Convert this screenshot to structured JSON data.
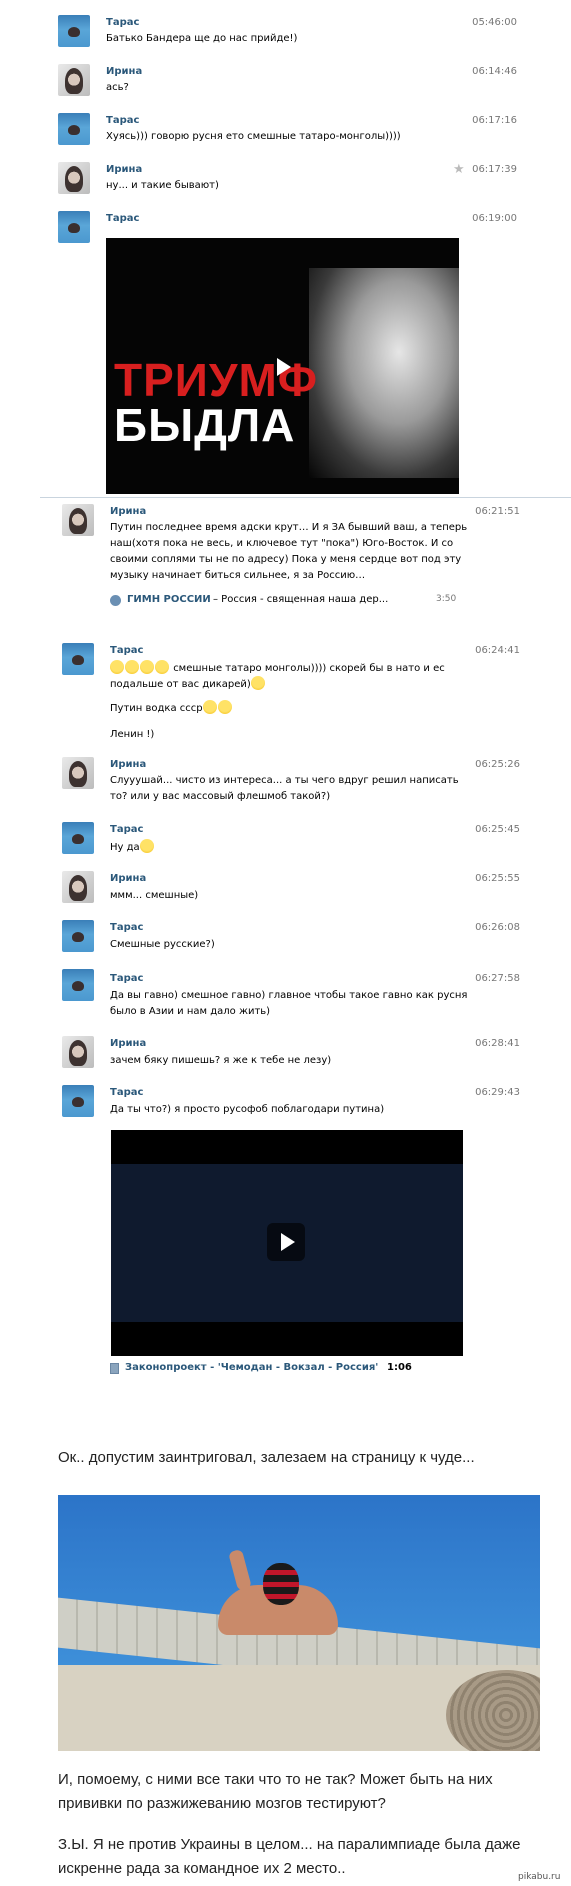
{
  "messages": [
    {
      "sender": "Тарас",
      "time": "05:46:00",
      "text": "Батько Бандера ще до нас прийде!)"
    },
    {
      "sender": "Ирина",
      "time": "06:14:46",
      "text": "ась?"
    },
    {
      "sender": "Тарас",
      "time": "06:17:16",
      "text": "Хуясь))) говорю русня ето смешные татаро-монголы))))"
    },
    {
      "sender": "Ирина",
      "time": "06:17:39",
      "text": "ну... и такие бывают)"
    },
    {
      "sender": "Тарас",
      "time": "06:19:00",
      "text": ""
    },
    {
      "sender": "Ирина",
      "time": "06:21:51",
      "lines": [
        "Путин последнее время адски крут… И я ЗА бывший ваш, а теперь",
        "наш(хотя пока не весь, и ключевое тут \"пока\") Юго-Восток. И со",
        "своими соплями ты не по адресу) Пока у меня сердце вот под эту",
        "музыку начинает биться сильнее, я за Россию…"
      ]
    },
    {
      "sender": "Тарас",
      "time": "06:24:41",
      "line1": "смешные татаро монголы)))) скорей бы в нато и ес",
      "line2": "подальше от вас дикарей)",
      "line3": "Путин водка ссср",
      "line4": "Ленин !)"
    },
    {
      "sender": "Ирина",
      "time": "06:25:26",
      "lines": [
        "Слууушай... чисто из интереса... а ты чего вдруг решил написать",
        "то? или у вас массовый флешмоб такой?)"
      ]
    },
    {
      "sender": "Тарас",
      "time": "06:25:45",
      "text": "Ну да"
    },
    {
      "sender": "Ирина",
      "time": "06:25:55",
      "text": "ммм... смешные)"
    },
    {
      "sender": "Тарас",
      "time": "06:26:08",
      "text": "Смешные русские?)"
    },
    {
      "sender": "Тарас",
      "time": "06:27:58",
      "lines": [
        "Да вы гавно) смешное гавно) главное чтобы такое гавно как русня",
        "было в Азии и нам дало жить)"
      ]
    },
    {
      "sender": "Ирина",
      "time": "06:28:41",
      "text": "зачем бяку пишешь? я же к тебе не лезу)"
    },
    {
      "sender": "Тарас",
      "time": "06:29:43",
      "text": "Да ты что?) я просто русофоб поблагодари путина)"
    }
  ],
  "video1": {
    "line1": "ТРИУМФ",
    "line2": "БЫДЛА"
  },
  "audio": {
    "title": "ГИМН РОССИИ",
    "subtitle": " – Россия - священная наша дер...",
    "duration": "3:50"
  },
  "video2": {
    "caption_title": "Законопроект - 'Чемодан - Вокзал - Россия'",
    "duration": "1:06"
  },
  "blog": {
    "para1": "Ок..  допустим заинтриговал, залезаем на страницу к чуде...",
    "para2a": "И, помоему, с ними все таки что то не так? Может быть на них",
    "para2b": "прививки по разжижеванию мозгов тестируют?",
    "para3a": "З.Ы. Я не против Украины в целом... на паралимпиаде была даже",
    "para3b": "искренне рада за командное их 2 место.."
  },
  "watermark": "pikabu.ru",
  "colors": {
    "name": "#2b587a",
    "time": "#777777",
    "link": "#2b587a"
  }
}
